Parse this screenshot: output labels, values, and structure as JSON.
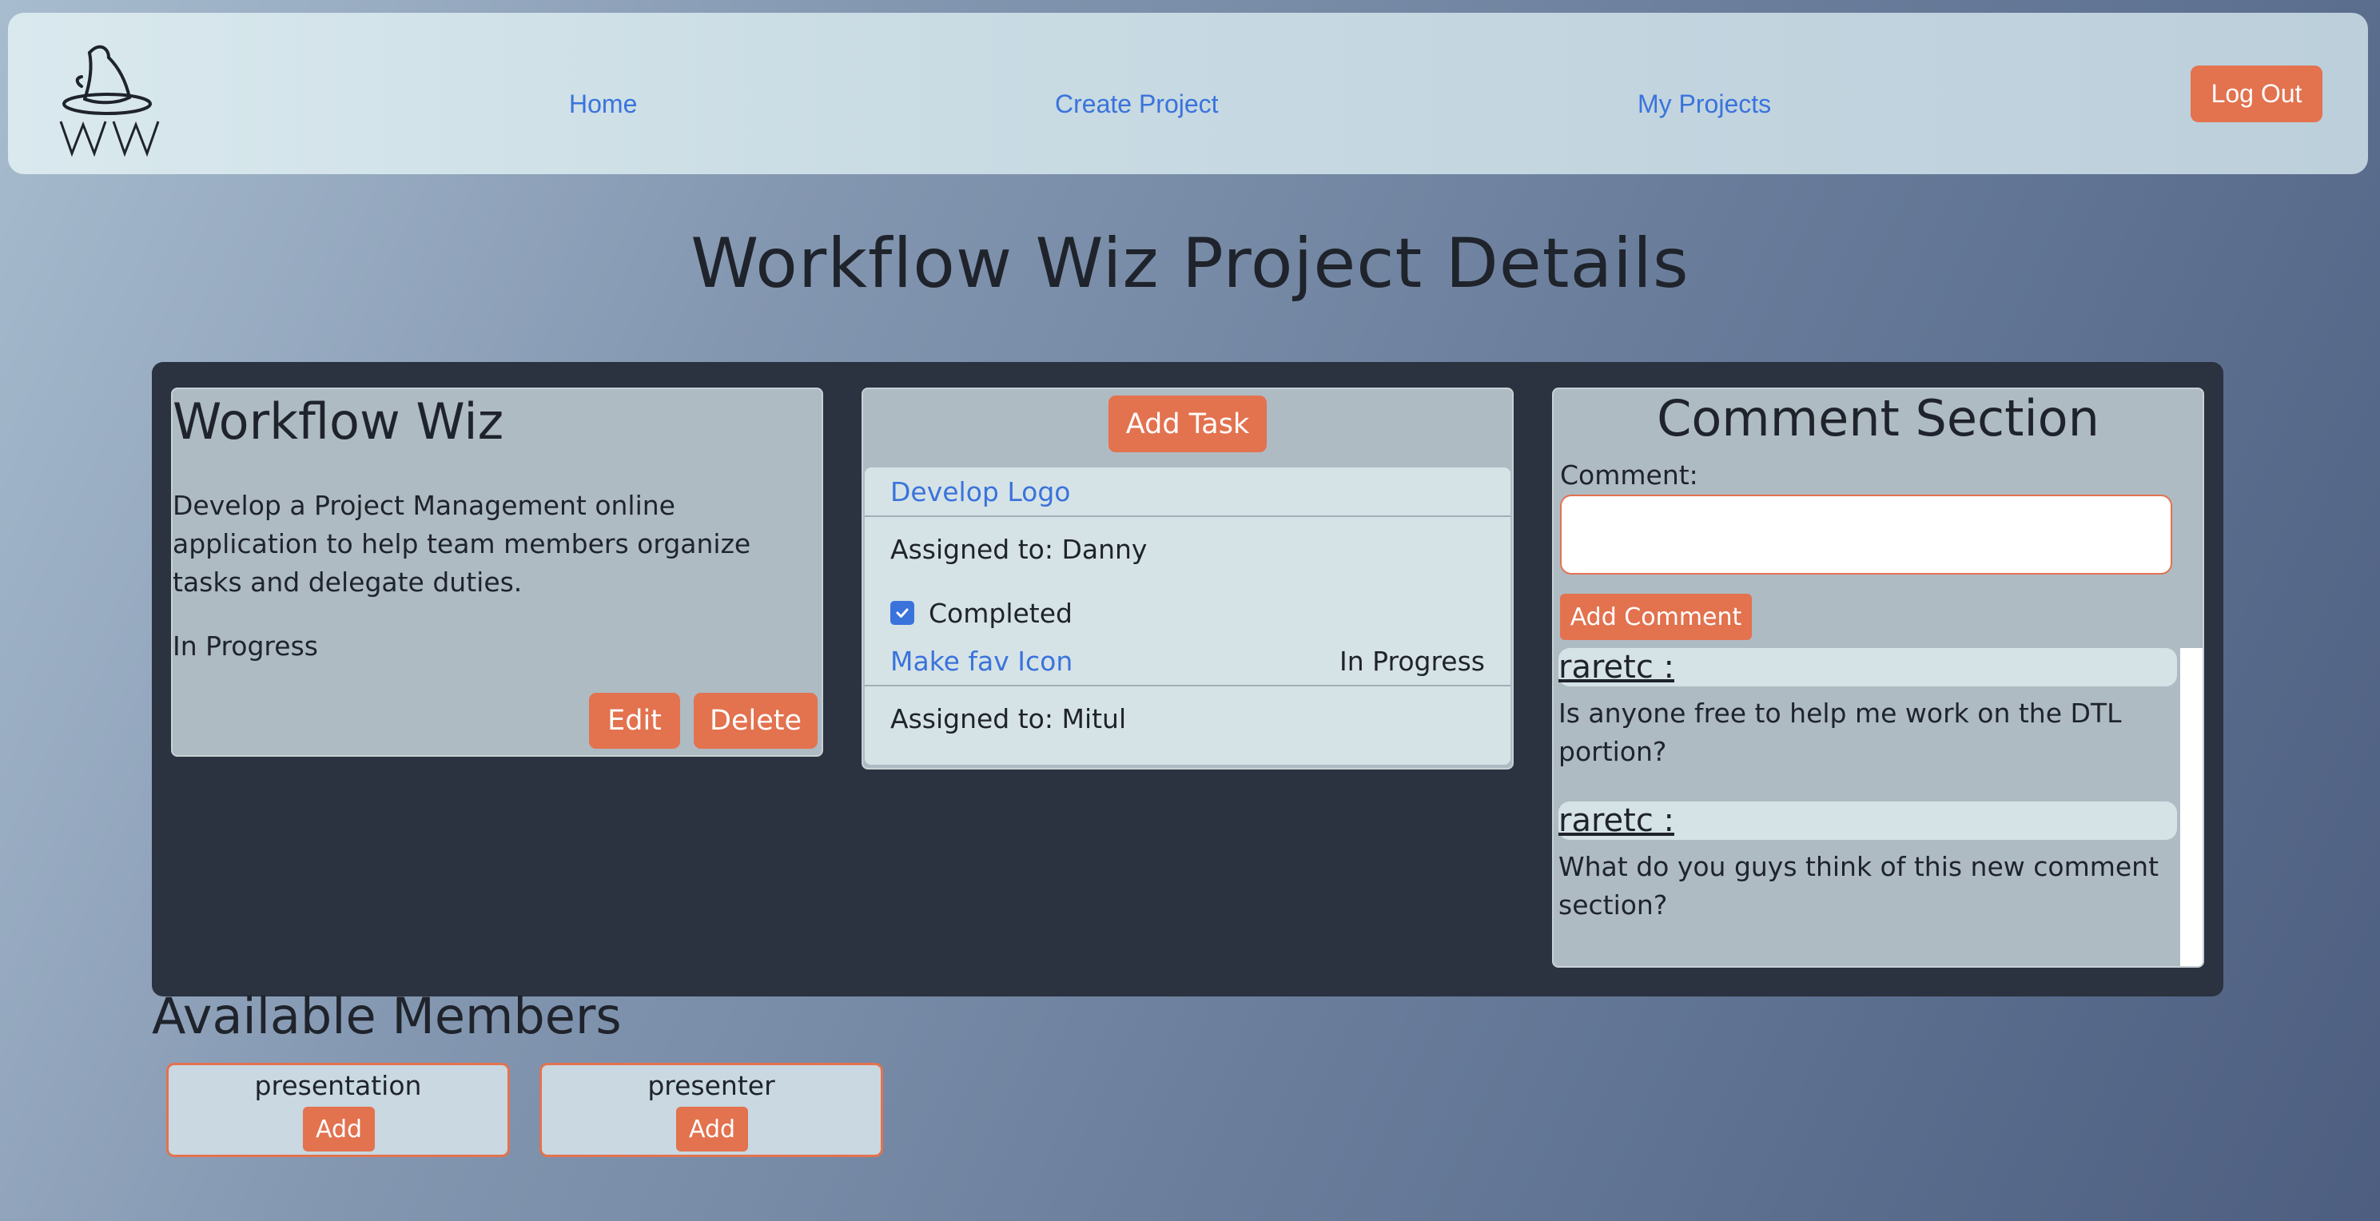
{
  "nav": {
    "home": "Home",
    "create_project": "Create Project",
    "my_projects": "My Projects",
    "logout": "Log Out"
  },
  "page_title": "Workflow Wiz Project Details",
  "project": {
    "name": "Workflow Wiz",
    "description": "Develop a Project Management online application to help team members organize tasks and delegate duties.",
    "status": "In Progress",
    "edit_label": "Edit",
    "delete_label": "Delete"
  },
  "tasks": {
    "add_label": "Add Task",
    "items": [
      {
        "name": "Develop Logo",
        "status": "",
        "assigned": "Assigned to: Danny",
        "completed_label": "Completed",
        "completed": true
      },
      {
        "name": "Make fav Icon",
        "status": "In Progress",
        "assigned": "Assigned to: Mitul"
      }
    ]
  },
  "comments": {
    "title": "Comment Section",
    "field_label": "Comment:",
    "input_value": "",
    "add_label": "Add Comment",
    "items": [
      {
        "user": "raretc :",
        "text": "Is anyone free to help me work on the DTL portion?"
      },
      {
        "user": "raretc :",
        "text": "What do you guys think of this new comment section?"
      }
    ]
  },
  "members": {
    "title": "Available Members",
    "items": [
      {
        "name": "presentation",
        "add_label": "Add"
      },
      {
        "name": "presenter",
        "add_label": "Add"
      }
    ]
  },
  "colors": {
    "accent": "#e3724f",
    "link": "#3a73dc",
    "panel_dark": "#2b3240",
    "card": "#aebbc3"
  },
  "icons": {
    "logo": "wizard-hat-logo-icon",
    "checkbox": "checkmark-icon"
  }
}
